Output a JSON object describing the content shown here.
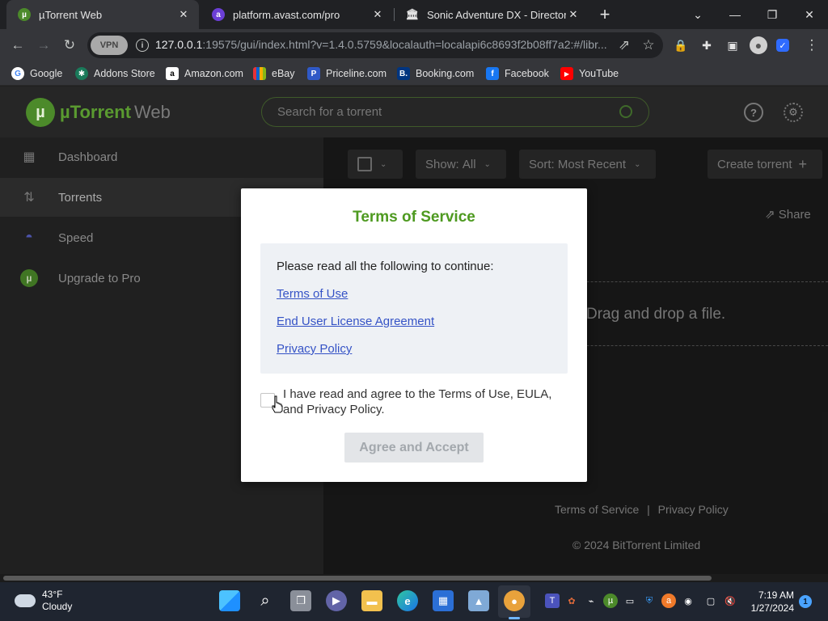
{
  "browser": {
    "tabs": [
      {
        "title": "µTorrent Web",
        "favicon": "utorrent-icon"
      },
      {
        "title": "platform.avast.com/pro",
        "favicon": "avast-icon"
      },
      {
        "title": "Sonic Adventure DX - Director's",
        "favicon": "museum-icon"
      }
    ],
    "url_host": "127.0.0.1",
    "url_rest": ":19575/gui/index.html?v=1.4.0.5759&localauth=localapi6c8693f2b08ff7a2:#/libr...",
    "vpn_label": "VPN",
    "bookmarks": [
      {
        "label": "Google",
        "color": "#ffffff"
      },
      {
        "label": "Addons Store",
        "color": "#1a7a5a"
      },
      {
        "label": "Amazon.com",
        "color": "#ffffff"
      },
      {
        "label": "eBay",
        "color": "#e53238"
      },
      {
        "label": "Priceline.com",
        "color": "#2f59c7"
      },
      {
        "label": "Booking.com",
        "color": "#003580"
      },
      {
        "label": "Facebook",
        "color": "#1877f2"
      },
      {
        "label": "YouTube",
        "color": "#ff0000"
      }
    ]
  },
  "app": {
    "logo_brand": "µTorrent",
    "logo_suffix": "Web",
    "search_placeholder": "Search for a torrent",
    "nav": [
      {
        "label": "Dashboard",
        "icon": "grid-icon"
      },
      {
        "label": "Torrents",
        "icon": "up-down-arrows-icon"
      },
      {
        "label": "Speed",
        "icon": "speedometer-icon"
      },
      {
        "label": "Upgrade to Pro",
        "icon": "utorrent-pro-icon"
      }
    ],
    "toolbar": {
      "show_label": "Show:",
      "show_value": "All",
      "sort_label": "Sort:",
      "sort_value": "Most Recent",
      "create_label": "Create torrent"
    },
    "share_label": "Share",
    "drop_text": "Drag and drop a file.",
    "footer": {
      "terms": "Terms of Service",
      "separator": "|",
      "privacy": "Privacy Policy",
      "copyright": "© 2024 BitTorrent Limited"
    }
  },
  "modal": {
    "title": "Terms of Service",
    "intro": "Please read all the following to continue:",
    "links": [
      "Terms of Use",
      "End User License Agreement",
      "Privacy Policy"
    ],
    "agree_text": "I have read and agree to the Terms of Use, EULA, and Privacy Policy.",
    "agree_checked": false,
    "accept_label": "Agree and Accept"
  },
  "taskbar": {
    "temperature": "43°F",
    "condition": "Cloudy",
    "time": "7:19 AM",
    "date": "1/27/2024",
    "notification_count": "1"
  },
  "colors": {
    "accent_green": "#4e9a20",
    "link_blue": "#3553c6"
  }
}
